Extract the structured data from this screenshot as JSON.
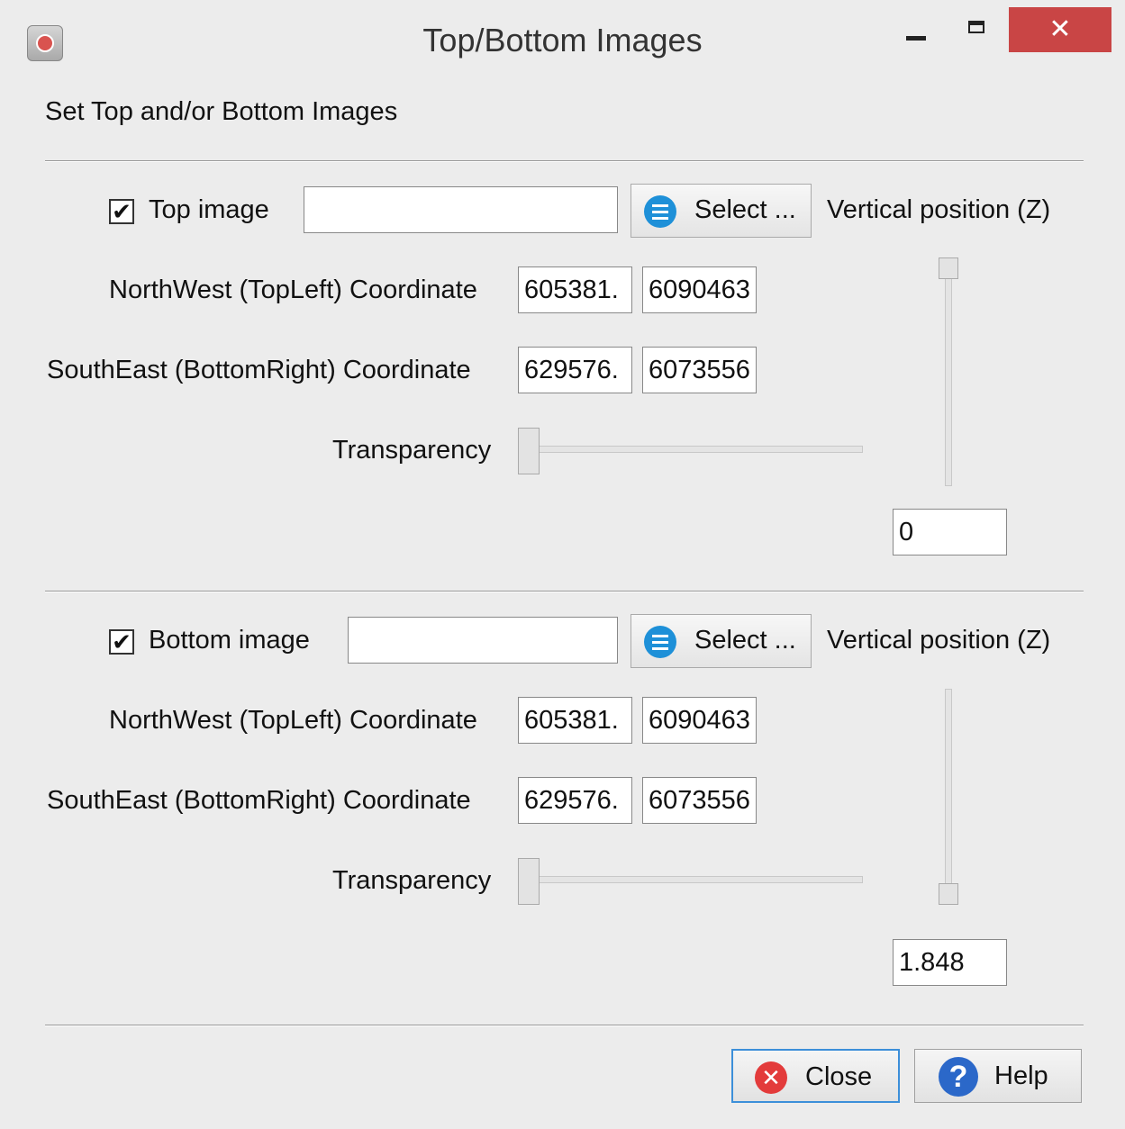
{
  "window": {
    "title": "Top/Bottom Images",
    "close_glyph": "✕"
  },
  "header": {
    "text": "Set Top and/or Bottom Images"
  },
  "top_image": {
    "checkbox_label": "Top image",
    "checked_glyph": "✔",
    "path_value": "",
    "select_label": "Select ...",
    "vertical_label": "Vertical position (Z)",
    "northwest_label": "NorthWest (TopLeft) Coordinate",
    "nw_x": "605381.",
    "nw_y": "6090463",
    "southeast_label": "SouthEast (BottomRight) Coordinate",
    "se_x": "629576.",
    "se_y": "6073556",
    "transparency_label": "Transparency",
    "transparency_level": 0,
    "vertical_level": 1,
    "z_value": "0"
  },
  "bottom_image": {
    "checkbox_label": "Bottom image",
    "checked_glyph": "✔",
    "path_value": "",
    "select_label": "Select ...",
    "vertical_label": "Vertical position (Z)",
    "northwest_label": "NorthWest (TopLeft) Coordinate",
    "nw_x": "605381.",
    "nw_y": "6090463",
    "southeast_label": "SouthEast (BottomRight) Coordinate",
    "se_x": "629576.",
    "se_y": "6073556",
    "transparency_label": "Transparency",
    "transparency_level": 0,
    "vertical_level": 0,
    "z_value": "1.848"
  },
  "buttons": {
    "close_label": "Close",
    "close_glyph": "✕",
    "help_label": "Help",
    "help_glyph": "?"
  },
  "colors": {
    "title_close": "#c94545",
    "select_icon": "#1e90d8",
    "close_icon": "#e33b3b",
    "help_icon": "#2b68c9",
    "focus": "#3c8fd9"
  }
}
